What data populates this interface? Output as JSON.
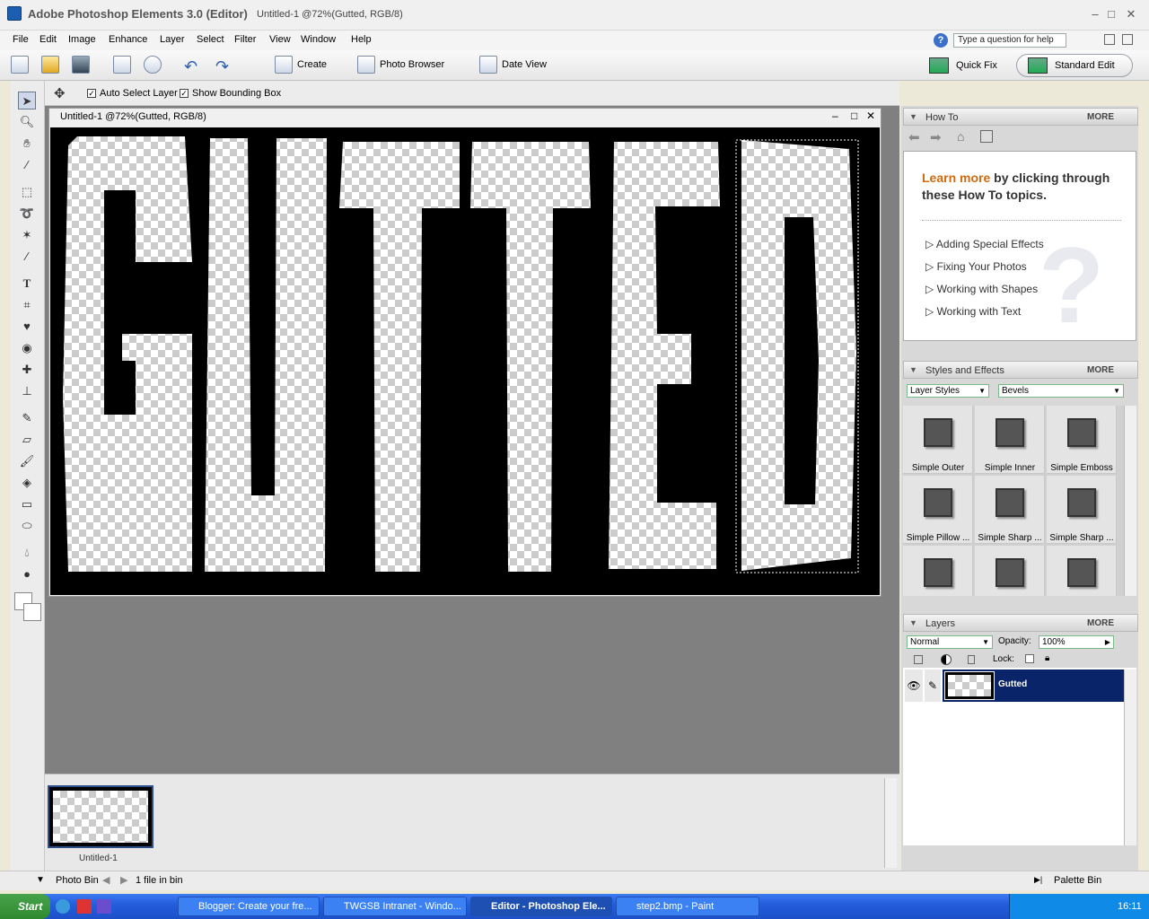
{
  "title": {
    "app": "Adobe Photoshop Elements 3.0 (Editor)",
    "doc": "Untitled-1 @72%(Gutted, RGB/8)"
  },
  "menu": [
    "File",
    "Edit",
    "Image",
    "Enhance",
    "Layer",
    "Select",
    "Filter",
    "View",
    "Window",
    "Help"
  ],
  "help": {
    "placeholder": "Type a question for help"
  },
  "toolbar": {
    "create": "Create",
    "photo_browser": "Photo Browser",
    "date_view": "Date View",
    "quick_fix": "Quick Fix",
    "standard_edit": "Standard Edit"
  },
  "options": {
    "auto_select": "Auto Select Layer",
    "show_bbox": "Show Bounding Box"
  },
  "document": {
    "title": "Untitled-1 @72%(Gutted, RGB/8)",
    "text": "GUTTED"
  },
  "howto": {
    "title": "How To",
    "more": "MORE",
    "learn_more": "Learn more",
    "intro": "by clicking through these How To topics.",
    "topics": [
      "Adding Special Effects",
      "Fixing Your Photos",
      "Working with Shapes",
      "Working with Text"
    ]
  },
  "styles": {
    "title": "Styles and Effects",
    "more": "MORE",
    "category": "Layer Styles",
    "subcategory": "Bevels",
    "items": [
      "Simple Outer",
      "Simple Inner",
      "Simple Emboss",
      "Simple Pillow ...",
      "Simple Sharp ...",
      "Simple Sharp ..."
    ]
  },
  "layers": {
    "title": "Layers",
    "more": "MORE",
    "blend": "Normal",
    "opacity_label": "Opacity:",
    "opacity": "100%",
    "lock_label": "Lock:",
    "layer_name": "Gutted"
  },
  "photobin": {
    "thumb_label": "Untitled-1",
    "label": "Photo Bin",
    "count": "1 file in bin",
    "palette_bin": "Palette Bin"
  },
  "taskbar": {
    "start": "Start",
    "tasks": [
      "Blogger: Create your fre...",
      "TWGSB Intranet - Windo...",
      "Editor - Photoshop Ele...",
      "step2.bmp - Paint"
    ],
    "clock": "16:11"
  }
}
